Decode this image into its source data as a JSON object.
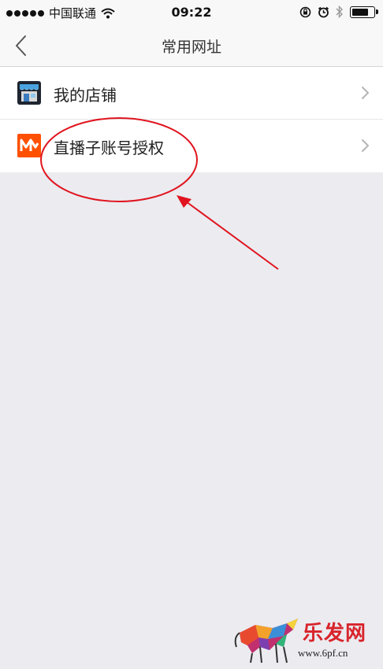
{
  "status_bar": {
    "carrier": "中国联通",
    "time": "09:22",
    "battery_level": 0.85
  },
  "nav": {
    "title": "常用网址",
    "back_icon": "chevron-left-icon"
  },
  "list": {
    "items": [
      {
        "label": "我的店铺",
        "icon": "store-icon"
      },
      {
        "label": "直播子账号授权",
        "icon": "live-m-logo-icon"
      }
    ]
  },
  "colors": {
    "accent_orange": "#ff5000",
    "annotation_red": "#e0141e",
    "background": "#ebebf0"
  },
  "watermark": {
    "brand": "乐发网",
    "url": "www.6pf.cn"
  }
}
